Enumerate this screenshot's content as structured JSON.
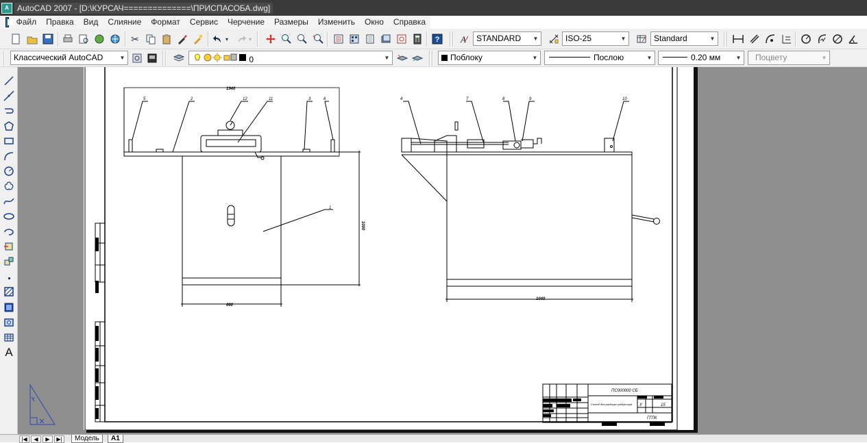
{
  "window": {
    "title": "AutoCAD 2007 - [D:\\КУРСАЧ==============\\ПРИСПАСОБА.dwg]",
    "app_icon": "autocad-icon"
  },
  "menu": [
    "Файл",
    "Правка",
    "Вид",
    "Слияние",
    "Формат",
    "Сервис",
    "Черчение",
    "Размеры",
    "Изменить",
    "Окно",
    "Справка"
  ],
  "toolbar_styles": {
    "text_style": "STANDARD",
    "dim_style": "ISO-25",
    "table_style": "Standard"
  },
  "toolbar_props": {
    "workspace": "Классический AutoCAD",
    "layer": "0",
    "color": "Поблоку",
    "linetype": "Послою",
    "lineweight": "0.20 мм",
    "plotstyle": "Поцвету"
  },
  "tabs": {
    "model": "Модель",
    "layout": "A1"
  },
  "drawing": {
    "dims": {
      "top_width": "1940",
      "height": "1000",
      "leg_width": "660",
      "side_width": "1040"
    },
    "leaders": [
      "1",
      "2",
      "3",
      "4",
      "5",
      "6",
      "7",
      "8",
      "9",
      "10",
      "11",
      "12"
    ],
    "title_block": {
      "designation": "ПС000000 СБ",
      "name": "Стенд для разборки редуктора",
      "sheets": "15",
      "org": "ГГПК",
      "litera": "У"
    }
  },
  "colors": {
    "titlebar": "#3a3a3a",
    "canvas_bg": "#8f8f8f",
    "sheet": "#ffffff",
    "toolbar": "#f0f0f0"
  }
}
